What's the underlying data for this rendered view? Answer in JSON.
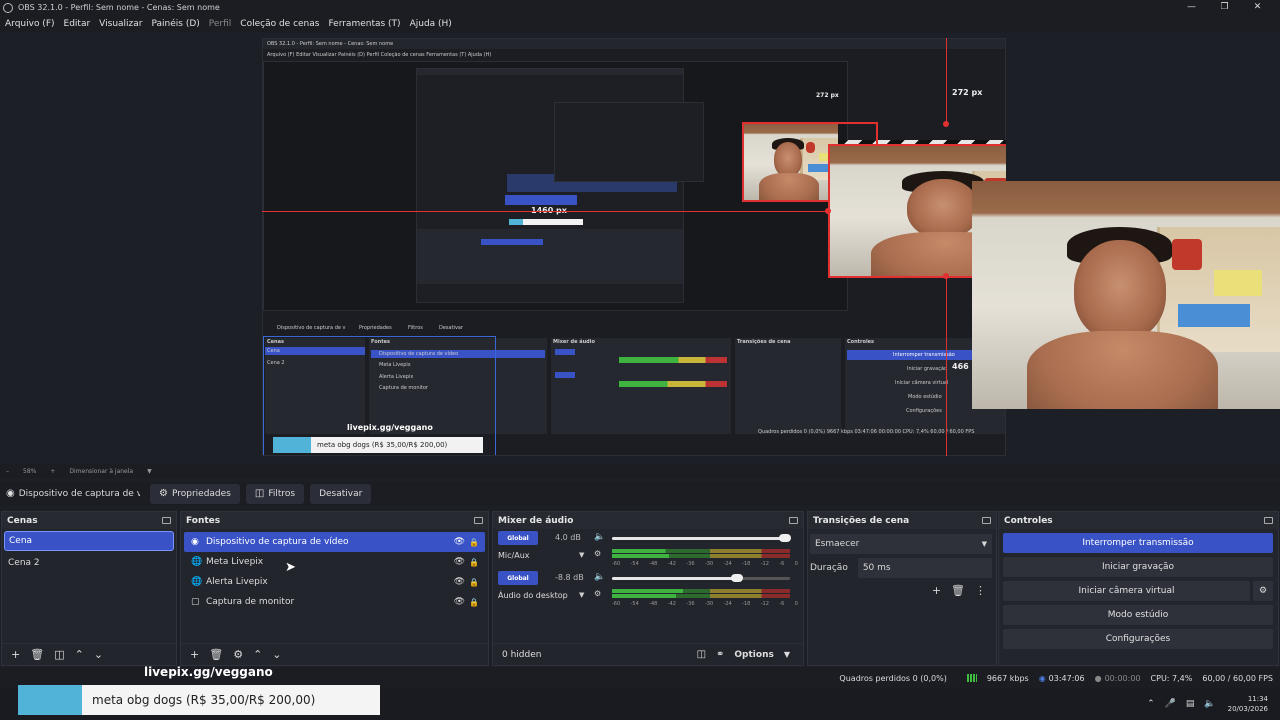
{
  "window": {
    "title": "OBS 32.1.0 - Perfil: Sem nome - Cenas: Sem nome",
    "min_icon": "minimize-icon",
    "max_icon": "maximize-icon",
    "close_icon": "close-icon"
  },
  "menu": {
    "arquivo": "Arquivo (F)",
    "editar": "Editar",
    "visualizar": "Visualizar",
    "paineis": "Painéis (D)",
    "perfil": "Perfil",
    "colecao": "Coleção de cenas",
    "ferramentas": "Ferramentas (T)",
    "ajuda": "Ajuda (H)"
  },
  "preview": {
    "label_272": "272 px",
    "label_1460": "1460 px",
    "label_466": "466 p",
    "nested_title": "OBS 32.1.0 - Perfil: Sem nome - Cenas: Sem nome",
    "nested_menu": "Arquivo (F)   Editar   Visualizar   Painéis (D)   Perfil   Coleção de cenas   Ferramentas (T)   Ajuda (H)",
    "nested_url": "livepix.gg/veggano",
    "nested_banner": "meta obg dogs (R$ 35,00/R$ 200,00)",
    "nested_sources": [
      "Dispositivo de captura de vídeo",
      "Meta Livepix",
      "Alerta Livepix",
      "Captura de monitor"
    ],
    "nested_scenes": [
      "Cena",
      "Cena 2"
    ],
    "nested_ctrl": [
      "Interromper transmissão",
      "Iniciar gravação",
      "Iniciar câmera virtual",
      "Modo estúdio",
      "Configurações"
    ],
    "nested_status": "Quadros perdidos 0 (0,0%)   9667 kbps   03:47:06   00:00:00   CPU: 7,4%   60,00 / 60,00 FPS",
    "nested_heads": [
      "Cenas",
      "Fontes",
      "Mixer de áudio",
      "Transições de cena",
      "Controles"
    ],
    "nested_ctx": [
      "Dispositivo de captura de v",
      "Propriedades",
      "Filtros",
      "Desativar"
    ]
  },
  "zoom": {
    "value": "58%",
    "resize_label": "Dimensionar à janela"
  },
  "context": {
    "source_name": "Dispositivo de captura de v",
    "properties": "Propriedades",
    "filters": "Filtros",
    "deactivate": "Desativar"
  },
  "scenes": {
    "title": "Cenas",
    "items": [
      "Cena",
      "Cena 2"
    ]
  },
  "sources": {
    "title": "Fontes",
    "items": [
      {
        "label": "Dispositivo de captura de vídeo",
        "icon": "camera-icon"
      },
      {
        "label": "Meta Livepix",
        "icon": "browser-icon"
      },
      {
        "label": "Alerta Livepix",
        "icon": "browser-icon"
      },
      {
        "label": "Captura de monitor",
        "icon": "monitor-icon"
      }
    ]
  },
  "mixer": {
    "title": "Mixer de áudio",
    "channels": [
      {
        "name": "Mic/Aux",
        "global": "Global",
        "db": "4.0 dB",
        "level": 0.97
      },
      {
        "name": "Áudio do desktop",
        "global": "Global",
        "db": "-8.8 dB",
        "level": 0.7
      }
    ],
    "ticks": [
      "-60",
      "-54",
      "-48",
      "-42",
      "-36",
      "-30",
      "-24",
      "-18",
      "-12",
      "-6",
      "0"
    ],
    "hidden": "0 hidden",
    "options": "Options"
  },
  "transitions": {
    "title": "Transições de cena",
    "selected": "Esmaecer",
    "duration_label": "Duração",
    "duration_value": "50 ms"
  },
  "controls": {
    "title": "Controles",
    "stop_stream": "Interromper transmissão",
    "start_recording": "Iniciar gravação",
    "virtual_camera": "Iniciar câmera virtual",
    "studio_mode": "Modo estúdio",
    "settings": "Configurações"
  },
  "status": {
    "dropped": "Quadros perdidos 0 (0,0%)",
    "bitrate": "9667 kbps",
    "stream_time": "03:47:06",
    "rec_time": "00:00:00",
    "cpu": "CPU: 7,4%",
    "fps": "60,00 / 60,00 FPS"
  },
  "overlay": {
    "url": "livepix.gg/veggano",
    "banner": "meta obg dogs (R$ 35,00/R$ 200,00)"
  },
  "taskbar": {
    "time": "11:34",
    "date": "20/03/2026"
  },
  "colors": {
    "accent": "#3953c6",
    "record_red": "#e03030",
    "banner_blue": "#52b3d9"
  }
}
